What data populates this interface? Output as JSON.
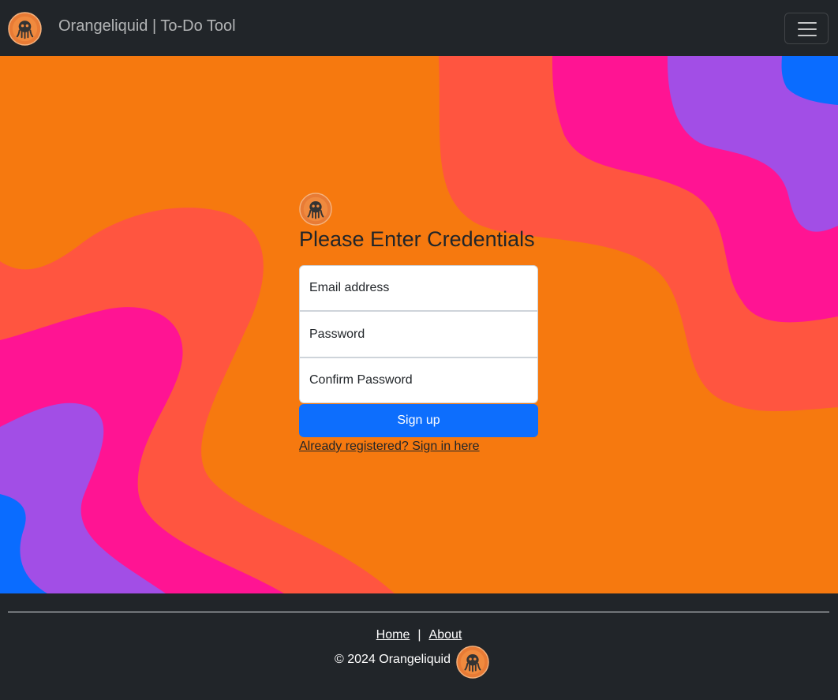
{
  "navbar": {
    "brand": "Orangeliquid | To-Do Tool",
    "logo_icon": "octopus-logo-icon",
    "menu_icon": "hamburger-menu-icon"
  },
  "signup_form": {
    "logo_icon": "octopus-logo-icon",
    "heading": "Please Enter Credentials",
    "email_placeholder": "Email address",
    "password_placeholder": "Password",
    "confirm_password_placeholder": "Confirm Password",
    "submit_label": "Sign up",
    "signin_link": "Already registered? Sign in here"
  },
  "footer": {
    "home_link": "Home",
    "separator": "|",
    "about_link": "About",
    "copyright": "© 2024 Orangeliquid",
    "logo_icon": "octopus-logo-icon"
  },
  "colors": {
    "navbar_bg": "#212529",
    "hero_orange": "#f6790f",
    "wave_red": "#ff5540",
    "wave_pink": "#ff1493",
    "wave_purple": "#a24ee6",
    "wave_blue": "#0a6cff",
    "primary_button": "#0d6efd"
  }
}
